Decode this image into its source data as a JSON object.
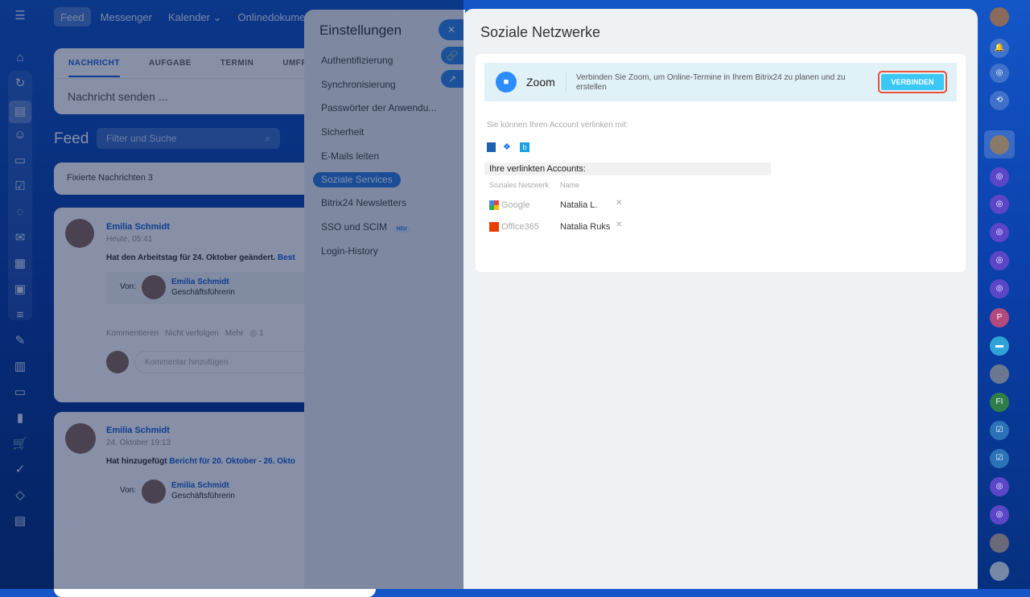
{
  "topnav": {
    "items": [
      "Feed",
      "Messenger",
      "Kalender",
      "Onlinedokumente"
    ]
  },
  "composer": {
    "tabs": [
      "NACHRICHT",
      "AUFGABE",
      "TERMIN",
      "UMFRAGE"
    ],
    "placeholder": "Nachricht senden ..."
  },
  "feed": {
    "title": "Feed",
    "search_placeholder": "Filter und Suche",
    "pinned": "Fixierte Nachrichten",
    "pinned_count": "3"
  },
  "posts": [
    {
      "author": "Emilia Schmidt",
      "time": "Heute, 05:41",
      "text": "Hat den Arbeitstag für 24. Oktober geändert.",
      "link": "Best",
      "from_label": "Von:",
      "from_name": "Emilia Schmidt",
      "from_role": "Geschäftsführerin",
      "actions": [
        "Kommentieren",
        "Nicht verfolgen",
        "Mehr"
      ],
      "views": "1",
      "comment_placeholder": "Kommentar hinzufügen"
    },
    {
      "author": "Emilia Schmidt",
      "time": "24. Oktober 19:13",
      "text": "Hat hinzugefügt",
      "link": "Bericht für 20. Oktober - 26. Okto",
      "from_label": "Von:",
      "from_name": "Emilia Schmidt",
      "from_role": "Geschäftsführerin"
    }
  ],
  "settings": {
    "title": "Einstellungen",
    "items": [
      "Authentifizierung",
      "Synchronisierung",
      "Passwörter der Anwendu...",
      "Sicherheit",
      "E-Mails leiten",
      "Soziale Services",
      "Bitrix24 Newsletters",
      "SSO und SCIM",
      "Login-History"
    ],
    "active": "Soziale Services",
    "badge": "NEU"
  },
  "panel": {
    "title": "Soziale Netzwerke",
    "zoom": {
      "name": "Zoom",
      "description": "Verbinden Sie Zoom, um Online-Termine in Ihrem Bitrix24 zu planen und zu erstellen",
      "button": "VERBINDEN"
    },
    "link_hint": "Sie können Ihren Account verlinken mit:",
    "linked_title": "Ihre verlinkten Accounts:",
    "columns": [
      "Soziales Netzwerk",
      "Name"
    ],
    "accounts": [
      {
        "network": "Google",
        "name": "Natalia L."
      },
      {
        "network": "Office365",
        "name": "Natalia Ruks"
      }
    ]
  },
  "right_sidebar": {
    "initials": [
      "P",
      "FI"
    ]
  },
  "colors": {
    "accent": "#2f7fe0",
    "zoom_button": "#3bc8f5",
    "highlight": "#e8503a"
  }
}
